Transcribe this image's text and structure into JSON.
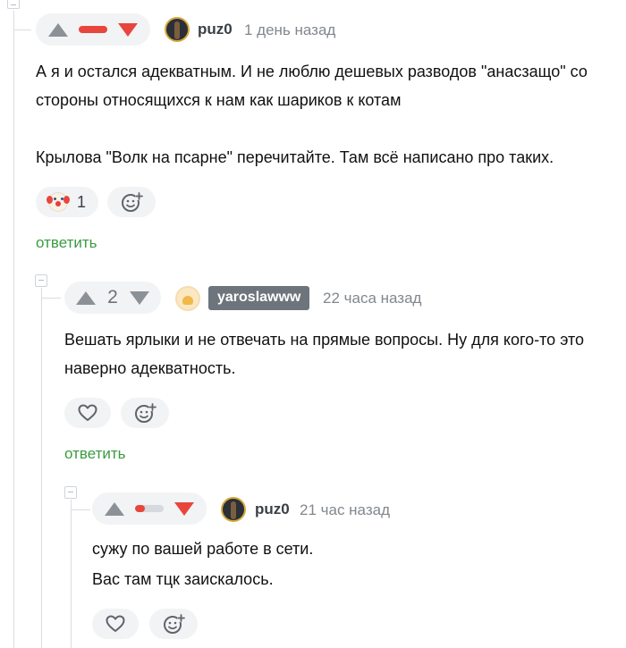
{
  "comments": [
    {
      "rating": {
        "score_text": "",
        "bar_fill": 1.0
      },
      "username": "puz0",
      "time": "1 день назад",
      "lines": [
        "А я и остался адекватным. И не люблю дешевых разводов \"анасзащо\" со",
        "стороны относящихся к нам как шариков к котам",
        "",
        "Крылова \"Волк на псарне\" перечитайте. Там всё написано про таких."
      ],
      "reaction_count": "1",
      "reply_label": "ответить"
    },
    {
      "rating": {
        "score_text": "2"
      },
      "username": "yaroslawww",
      "time": "22 часа назад",
      "lines": [
        "Вешать ярлыки и не отвечать на прямые вопросы. Ну для кого-то это",
        "наверно адекватность."
      ],
      "reply_label": "ответить"
    },
    {
      "rating": {
        "score_text": "",
        "bar_fill": 0.35
      },
      "username": "puz0",
      "time": "21 час назад",
      "lines": [
        "сужу по вашей работе в сети.",
        "Вас там тцк заискалось."
      ]
    }
  ],
  "colors": {
    "accent_green": "#3a9b40",
    "downvote_red": "#e8463d",
    "pill_bg": "#f2f3f5"
  },
  "icons": {
    "upvote": "triangle-up-icon",
    "downvote": "triangle-down-icon",
    "like": "heart-icon",
    "add_reaction": "smiley-plus-icon",
    "reaction": "clown-face-icon"
  }
}
